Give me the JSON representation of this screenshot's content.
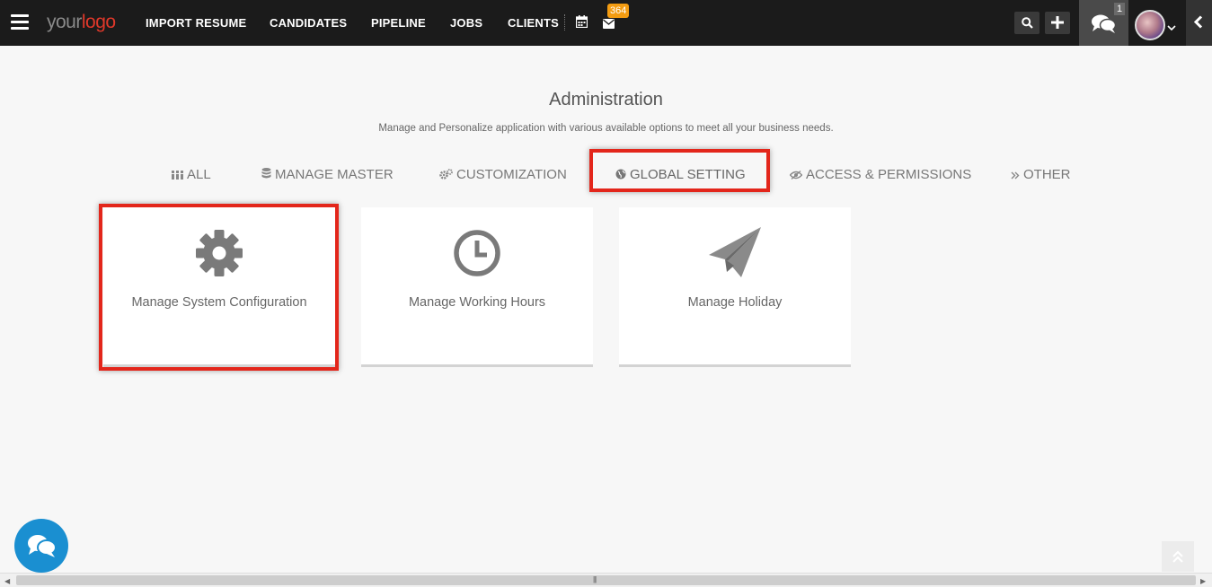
{
  "navbar": {
    "logo_part1": "your",
    "logo_part2": "logo",
    "items": [
      {
        "label": "IMPORT RESUME"
      },
      {
        "label": "CANDIDATES"
      },
      {
        "label": "PIPELINE"
      },
      {
        "label": "JOBS"
      },
      {
        "label": "CLIENTS"
      }
    ],
    "mail_badge": "364",
    "chat_count": "1"
  },
  "page": {
    "title": "Administration",
    "subtitle": "Manage and Personalize application with various available options to meet all your business needs."
  },
  "tabs": [
    {
      "label": "ALL",
      "icon": "grid-icon"
    },
    {
      "label": "MANAGE MASTER",
      "icon": "database-icon"
    },
    {
      "label": "CUSTOMIZATION",
      "icon": "cogs-icon"
    },
    {
      "label": "GLOBAL SETTING",
      "icon": "globe-icon",
      "active": true
    },
    {
      "label": "ACCESS & PERMISSIONS",
      "icon": "eye-icon"
    },
    {
      "label": "OTHER",
      "icon": "double-chevron-right-icon"
    }
  ],
  "cards": [
    {
      "label": "Manage System Configuration",
      "icon": "gear-icon"
    },
    {
      "label": "Manage Working Hours",
      "icon": "clock-icon"
    },
    {
      "label": "Manage Holiday",
      "icon": "paper-plane-icon"
    }
  ],
  "colors": {
    "navbar_bg": "#1b1b1b",
    "highlight": "#e3261b",
    "badge": "#f39c12",
    "chat_fab": "#1a8fd1",
    "logo_accent": "#e0382a"
  }
}
